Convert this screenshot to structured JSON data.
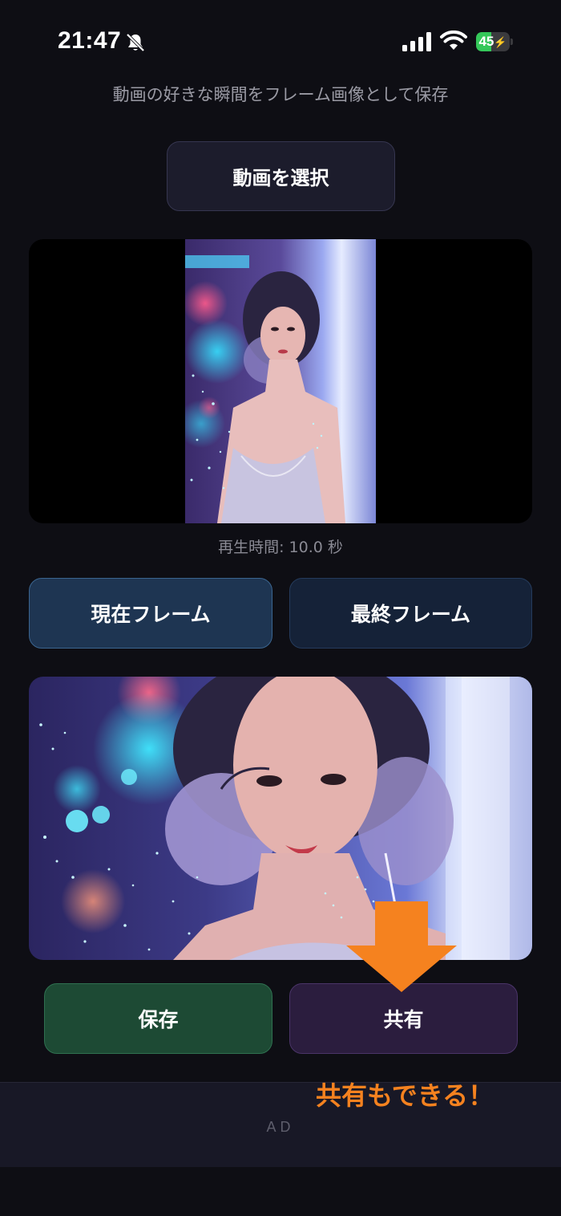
{
  "status_bar": {
    "time": "21:47",
    "battery_level": "45",
    "battery_fraction": 0.45,
    "icons": [
      "bell-slash-icon",
      "cellular-signal-icon",
      "wifi-icon",
      "battery-charging-icon"
    ]
  },
  "header": {
    "subtitle": "動画の好きな瞬間をフレーム画像として保存"
  },
  "controls": {
    "select_video_label": "動画を選択",
    "duration_text": "再生時間: 10.0 秒",
    "current_frame_label": "現在フレーム",
    "last_frame_label": "最終フレーム",
    "save_label": "保存",
    "share_label": "共有"
  },
  "annotation": {
    "text": "共有もできる！",
    "color": "#f5821f"
  },
  "ad": {
    "label": "AD"
  },
  "colors": {
    "background": "#0e0e14",
    "select_button": "#1c1c2c",
    "current_frame_button": "#1e3552",
    "last_frame_button": "#152238",
    "save_button": "#1d4a34",
    "share_button": "#2b1d3e",
    "battery_green": "#34c759"
  }
}
